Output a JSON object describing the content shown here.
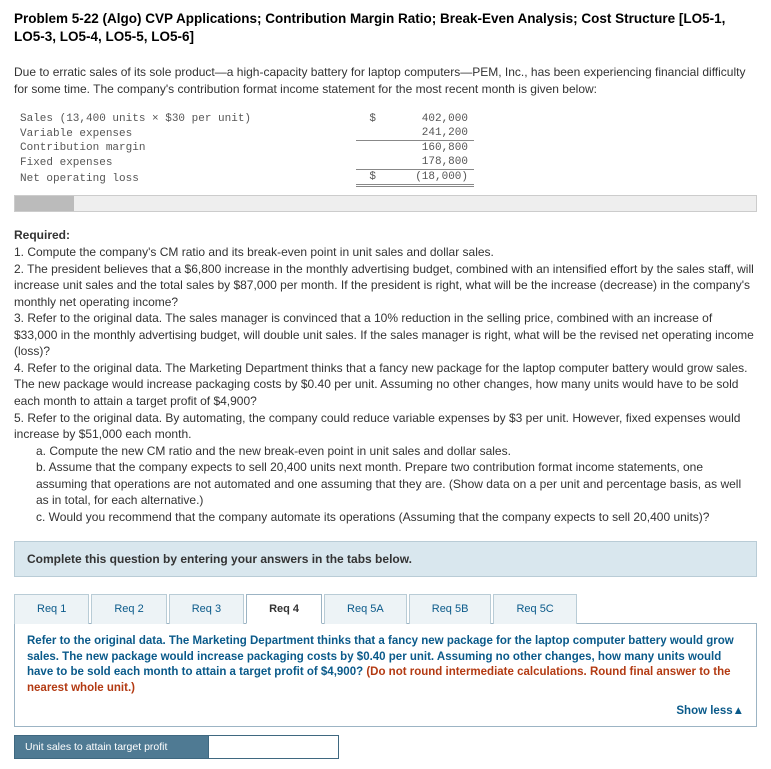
{
  "title": "Problem 5-22 (Algo) CVP Applications; Contribution Margin Ratio; Break-Even Analysis; Cost Structure [LO5-1, LO5-3, LO5-4, LO5-5, LO5-6]",
  "intro": "Due to erratic sales of its sole product—a high-capacity battery for laptop computers—PEM, Inc., has been experiencing financial difficulty for some time. The company's contribution format income statement for the most recent month is given below:",
  "statement": {
    "rows": [
      {
        "label": "Sales (13,400 units × $30 per unit)",
        "cur": "$",
        "val": "402,000"
      },
      {
        "label": "Variable expenses",
        "cur": "",
        "val": "241,200"
      },
      {
        "label": "Contribution margin",
        "cur": "",
        "val": "160,800"
      },
      {
        "label": "Fixed expenses",
        "cur": "",
        "val": "178,800"
      },
      {
        "label": "Net operating loss",
        "cur": "$",
        "val": "(18,000)"
      }
    ]
  },
  "required_heading": "Required:",
  "requirements": {
    "r1": "1. Compute the company's CM ratio and its break-even point in unit sales and dollar sales.",
    "r2": "2. The president believes that a $6,800 increase in the monthly advertising budget, combined with an intensified effort by the sales staff, will increase unit sales and the total sales by $87,000 per month. If the president is right, what will be the increase (decrease) in the company's monthly net operating income?",
    "r3": "3. Refer to the original data. The sales manager is convinced that a 10% reduction in the selling price, combined with an increase of $33,000 in the monthly advertising budget, will double unit sales. If the sales manager is right, what will be the revised net operating income (loss)?",
    "r4": "4. Refer to the original data. The Marketing Department thinks that a fancy new package for the laptop computer battery would grow sales. The new package would increase packaging costs by $0.40 per unit. Assuming no other changes, how many units would have to be sold each month to attain a target profit of $4,900?",
    "r5": "5. Refer to the original data. By automating, the company could reduce variable expenses by $3 per unit. However, fixed expenses would increase by $51,000 each month.",
    "r5a": "a. Compute the new CM ratio and the new break-even point in unit sales and dollar sales.",
    "r5b": "b. Assume that the company expects to sell 20,400 units next month. Prepare two contribution format income statements, one assuming that operations are not automated and one assuming that they are. (Show data on a per unit and percentage basis, as well as in total, for each alternative.)",
    "r5c": "c. Would you recommend that the company automate its operations (Assuming that the company expects to sell 20,400 units)?"
  },
  "answer_box": "Complete this question by entering your answers in the tabs below.",
  "tabs": {
    "t1": "Req 1",
    "t2": "Req 2",
    "t3": "Req 3",
    "t4": "Req 4",
    "t5a": "Req 5A",
    "t5b": "Req 5B",
    "t5c": "Req 5C"
  },
  "panel": {
    "instr_main": "Refer to the original data. The Marketing Department thinks that a fancy new package for the laptop computer battery would grow sales. The new package would increase packaging costs by $0.40 per unit. Assuming no other changes, how many units would have to be sold each month to attain a target profit of $4,900? ",
    "instr_note": "(Do not round intermediate calculations. Round final answer to the nearest whole unit.)",
    "showless": "Show less▲"
  },
  "answer_row": {
    "label": "Unit sales to attain target profit",
    "value": ""
  }
}
